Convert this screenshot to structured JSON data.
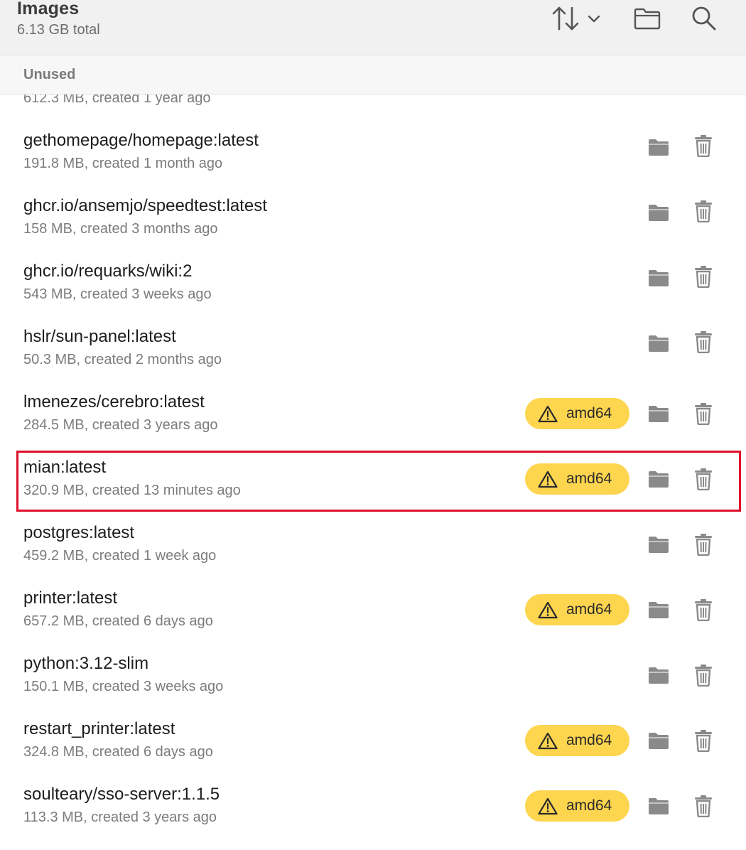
{
  "header": {
    "title": "Images",
    "subtitle": "6.13 GB total",
    "sort_icon": "sort-arrows-icon",
    "sort_chevron_icon": "chevron-down-icon",
    "folder_icon": "folder-icon",
    "search_icon": "search-icon"
  },
  "section": {
    "label": "Unused"
  },
  "colors": {
    "badge_bg": "#fdd54f",
    "highlight_border": "#e0102a",
    "icon_gray": "#8a8a8a"
  },
  "partial_row": {
    "meta": "612.3 MB, created 1 year ago"
  },
  "images": [
    {
      "name": "gethomepage/homepage:latest",
      "meta": "191.8 MB, created 1 month ago",
      "badge": ""
    },
    {
      "name": "ghcr.io/ansemjo/speedtest:latest",
      "meta": "158 MB, created 3 months ago",
      "badge": ""
    },
    {
      "name": "ghcr.io/requarks/wiki:2",
      "meta": "543 MB, created 3 weeks ago",
      "badge": ""
    },
    {
      "name": "hslr/sun-panel:latest",
      "meta": "50.3 MB, created 2 months ago",
      "badge": ""
    },
    {
      "name": "lmenezes/cerebro:latest",
      "meta": "284.5 MB, created 3 years ago",
      "badge": "amd64"
    },
    {
      "name": "mian:latest",
      "meta": "320.9 MB, created 13 minutes ago",
      "badge": "amd64"
    },
    {
      "name": "postgres:latest",
      "meta": "459.2 MB, created 1 week ago",
      "badge": ""
    },
    {
      "name": "printer:latest",
      "meta": "657.2 MB, created 6 days ago",
      "badge": "amd64"
    },
    {
      "name": "python:3.12-slim",
      "meta": "150.1 MB, created 3 weeks ago",
      "badge": ""
    },
    {
      "name": "restart_printer:latest",
      "meta": "324.8 MB, created 6 days ago",
      "badge": "amd64"
    },
    {
      "name": "soulteary/sso-server:1.1.5",
      "meta": "113.3 MB, created 3 years ago",
      "badge": "amd64"
    }
  ]
}
